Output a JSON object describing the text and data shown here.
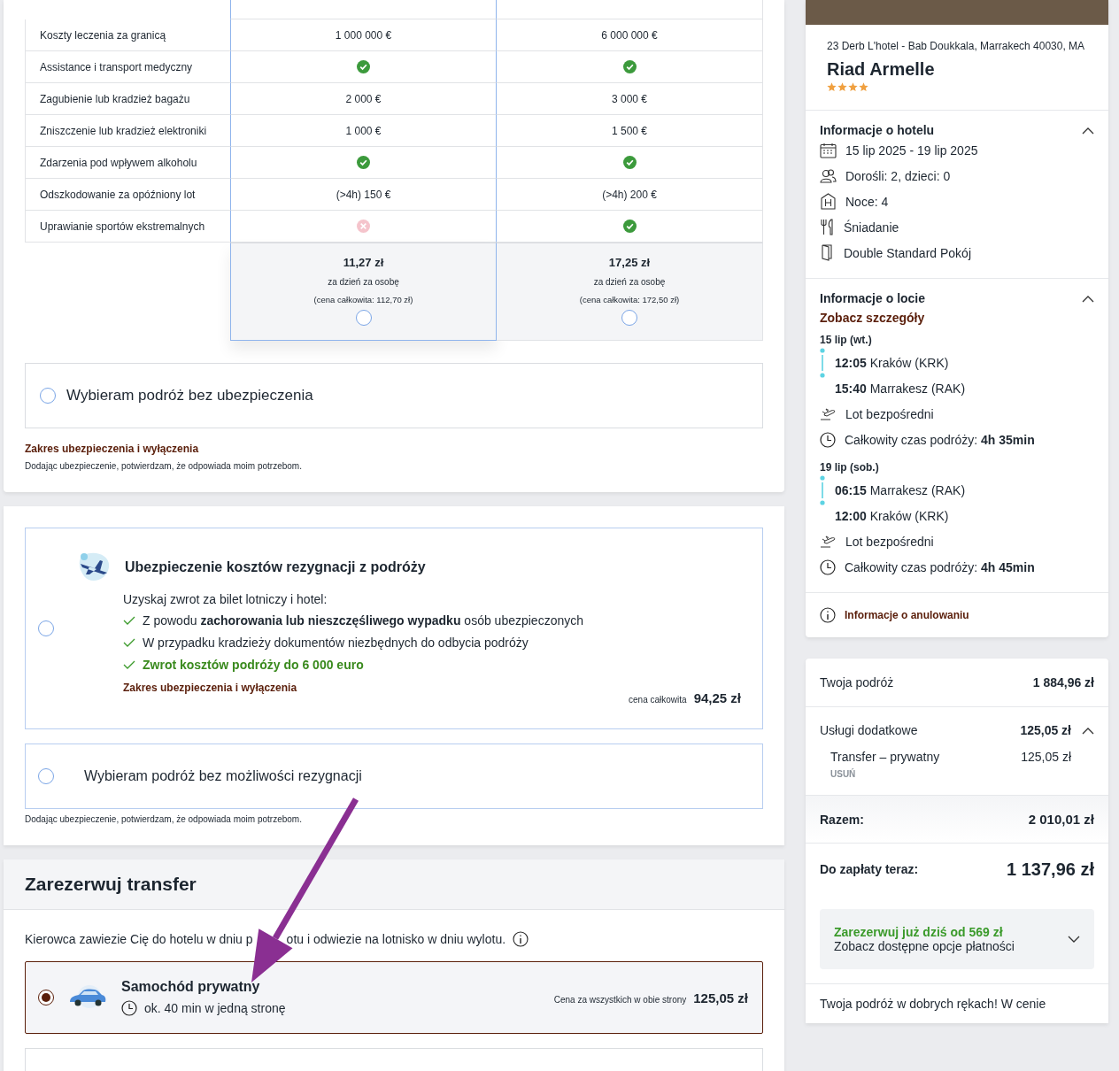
{
  "insurance_table": {
    "plans": [
      {
        "highlighted": true,
        "selected": false,
        "price": "11,27 zł",
        "per_day": "za dzień za osobę",
        "total": "(cena całkowita: 112,70 zł)"
      },
      {
        "highlighted": false,
        "selected": false,
        "price": "17,25 zł",
        "per_day": "za dzień za osobę",
        "total": "(cena całkowita: 172,50 zł)"
      }
    ],
    "rows": [
      {
        "label": "Koszty leczenia za granicą",
        "cells": [
          {
            "kind": "text",
            "text": "1 000 000 €"
          },
          {
            "kind": "text",
            "text": "6 000 000 €"
          }
        ]
      },
      {
        "label": "Assistance i transport medyczny",
        "cells": [
          {
            "kind": "check"
          },
          {
            "kind": "check"
          }
        ]
      },
      {
        "label": "Zagubienie lub kradzież bagażu",
        "cells": [
          {
            "kind": "text",
            "text": "2 000 €"
          },
          {
            "kind": "text",
            "text": "3 000 €"
          }
        ]
      },
      {
        "label": "Zniszczenie lub kradzież elektroniki",
        "cells": [
          {
            "kind": "text",
            "text": "1 000 €"
          },
          {
            "kind": "text",
            "text": "1 500 €"
          }
        ]
      },
      {
        "label": "Zdarzenia pod wpływem alkoholu",
        "cells": [
          {
            "kind": "check"
          },
          {
            "kind": "check"
          }
        ]
      },
      {
        "label": "Odszkodowanie za opóźniony lot",
        "cells": [
          {
            "kind": "text",
            "text": "(>4h) 150 €"
          },
          {
            "kind": "text",
            "text": "(>4h) 200 €"
          }
        ]
      },
      {
        "label": "Uprawianie sportów ekstremalnych",
        "cells": [
          {
            "kind": "cross"
          },
          {
            "kind": "check"
          }
        ]
      }
    ]
  },
  "no_insurance_option": {
    "label": "Wybieram podróż bez ubezpieczenia",
    "selected": false
  },
  "insurance_terms_link": "Zakres ubezpieczenia i wyłączenia",
  "insurance_note": "Dodając ubezpieczenie, potwierdzam, że odpowiada moim potrzebom.",
  "cancellation_insurance": {
    "selected": false,
    "title": "Ubezpieczenie kosztów rezygnacji z podróży",
    "intro": "Uzyskaj zwrot za bilet lotniczy i hotel:",
    "benefits": [
      {
        "text": "Z powodu **zachorowania lub nieszczęśliwego wypadku** osób ubezpieczonych",
        "highlight": false
      },
      {
        "text": "W przypadku kradzieży dokumentów niezbędnych do odbycia podróży",
        "highlight": false
      },
      {
        "text": "Zwrot kosztów podróży do 6 000 euro",
        "highlight": true
      }
    ],
    "terms_link": "Zakres ubezpieczenia i wyłączenia",
    "price_label": "cena całkowita",
    "price": "94,25 zł"
  },
  "no_cancellation_option": {
    "label": "Wybieram podróż bez możliwości rezygnacji",
    "selected": false
  },
  "cancellation_note": "Dodając ubezpieczenie, potwierdzam, że odpowiada moim potrzebom.",
  "transfer": {
    "title": "Zarezerwuj transfer",
    "intro_before": "Kierowca zawiezie Cię do hotelu w dniu p",
    "intro_after": "otu i odwiezie na lotnisko w dniu wylotu.",
    "options": [
      {
        "selected": true,
        "name": "Samochód prywatny",
        "duration": "ok. 40 min w jedną stronę",
        "price_label": "Cena za wszystkich w obie strony",
        "price": "125,05 zł"
      }
    ]
  },
  "hotel": {
    "address": "23 Derb L'hotel - Bab Doukkala, Marrakech 40030, MA",
    "name": "Riad Armelle",
    "stars": 4,
    "info_title": "Informacje o hotelu",
    "info_expanded": true,
    "info_items": [
      {
        "kind": "calendar",
        "text": "15 lip 2025 - 19 lip 2025"
      },
      {
        "kind": "people",
        "text": "Dorośli: 2, dzieci: 0"
      },
      {
        "kind": "hotel",
        "text": "Noce: 4"
      },
      {
        "kind": "meal",
        "text": "Śniadanie"
      },
      {
        "kind": "room",
        "text": "Double Standard Pokój"
      }
    ],
    "flight_title": "Informacje o locie",
    "flight_expanded": true,
    "flight_details_link": "Zobacz szczegóły",
    "flights": [
      {
        "date": "15 lip (wt.)",
        "departure_time": "12:05",
        "departure_place": "Kraków (KRK)",
        "arrival_time": "15:40",
        "arrival_place": "Marrakesz (RAK)",
        "type": "Lot bezpośredni",
        "duration": "Całkowity czas podróży: **4h 35min**"
      },
      {
        "date": "19 lip (sob.)",
        "departure_time": "06:15",
        "departure_place": "Marrakesz (RAK)",
        "arrival_time": "12:00",
        "arrival_place": "Kraków (KRK)",
        "type": "Lot bezpośredni",
        "duration": "Całkowity czas podróży: **4h 45min**"
      }
    ],
    "cancellation_link": "Informacje o anulowaniu"
  },
  "summary": {
    "trip_label": "Twoja podróż",
    "trip_price": "1 884,96 zł",
    "extras_label": "Usługi dodatkowe",
    "extras_price": "125,05 zł",
    "extras_expanded": true,
    "extras": [
      {
        "name": "Transfer – prywatny",
        "price": "125,05 zł",
        "remove": "USUŃ"
      }
    ],
    "total_label": "Razem:",
    "total": "2 010,01 zł",
    "due_label": "Do zapłaty teraz:",
    "due": "1 137,96 zł",
    "payment_promo": "Zarezerwuj już dziś od 569 zł",
    "payment_link": "Zobacz dostępne opcje płatności",
    "footer_text": "Twoja podróż w dobrych rękach! W cenie"
  }
}
